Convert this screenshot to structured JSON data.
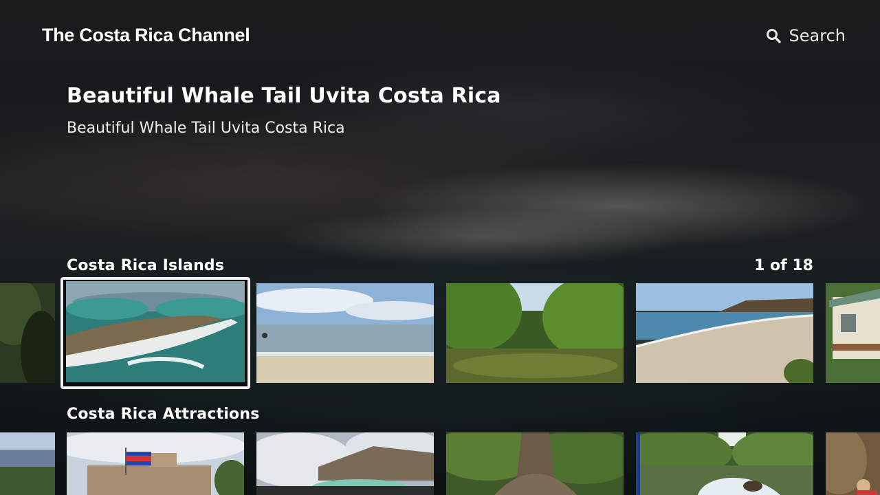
{
  "app": {
    "title": "The Costa Rica Channel"
  },
  "search": {
    "label": "Search",
    "icon": "search-icon"
  },
  "feature": {
    "title": "Beautiful Whale Tail Uvita Costa Rica",
    "description": "Beautiful Whale Tail Uvita Costa Rica"
  },
  "rows": [
    {
      "label": "Costa Rica Islands",
      "position": "1 of 18",
      "selected_index": 0
    },
    {
      "label": "Costa Rica Attractions"
    }
  ],
  "colors": {
    "focus_border": "#f2f2f2",
    "text": "#ffffff"
  }
}
